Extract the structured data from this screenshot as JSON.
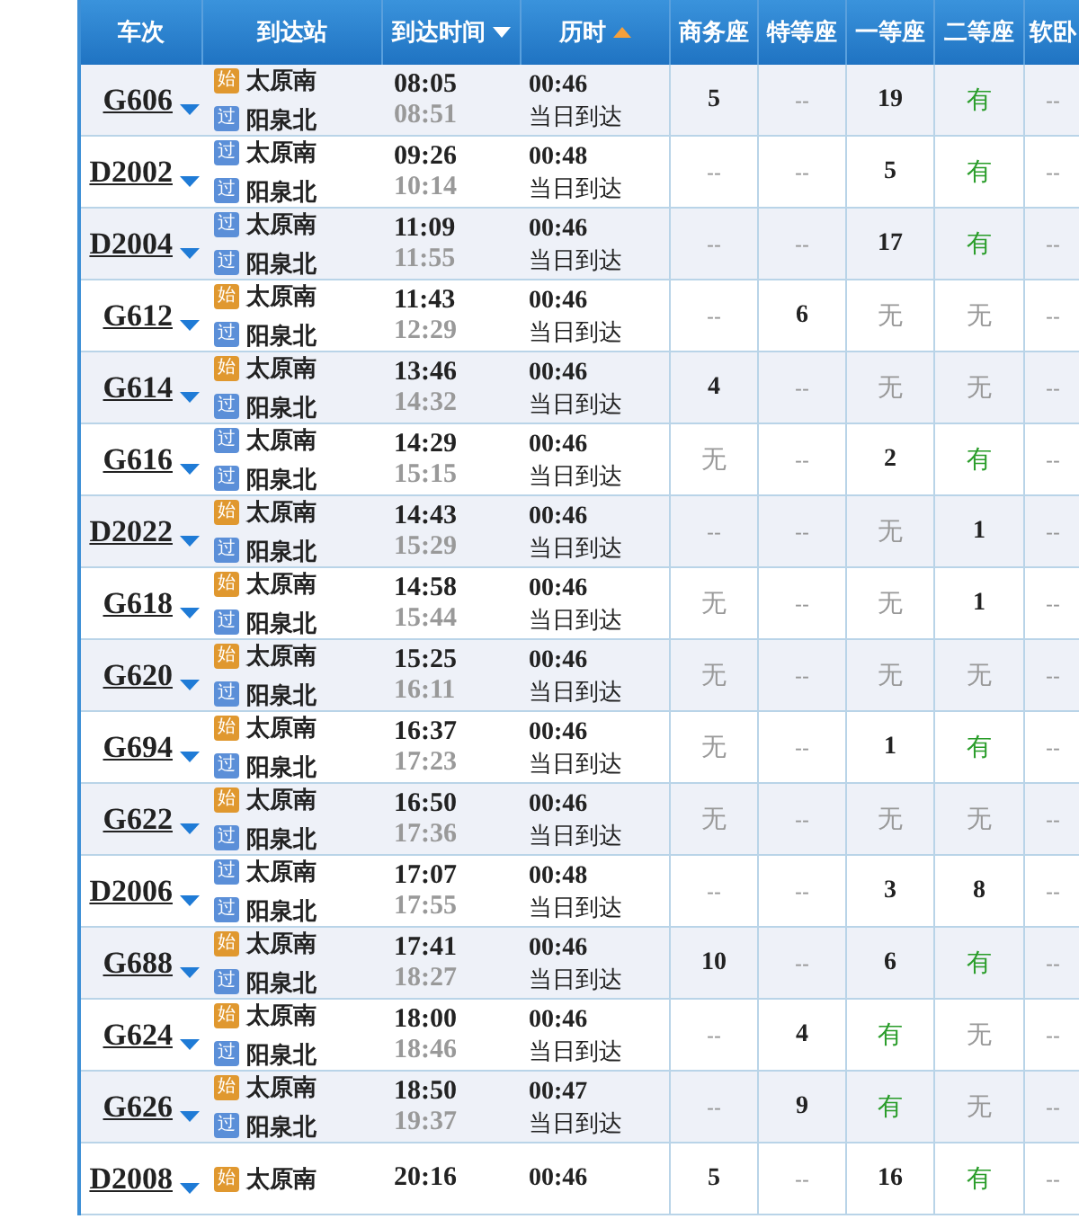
{
  "columns": [
    {
      "label": "车次"
    },
    {
      "label": "到达站"
    },
    {
      "label": "到达时间",
      "sorted": true,
      "descending": true
    },
    {
      "label": "历时",
      "sorted": true,
      "descending": false
    },
    {
      "label": "商务座"
    },
    {
      "label": "特等座"
    },
    {
      "label": "一等座"
    },
    {
      "label": "二等座"
    },
    {
      "label": "软卧"
    }
  ],
  "rows": [
    {
      "train": "G606",
      "from_badge": {
        "text": "始",
        "kind": "origin"
      },
      "from": "太原南",
      "to_badge": {
        "text": "过",
        "kind": "pass"
      },
      "to": "阳泉北",
      "depart": "08:05",
      "arrive": "08:51",
      "duration": "00:46",
      "arrival_day": "当日到达",
      "seats": [
        {
          "text": "5",
          "kind": "count"
        },
        {
          "text": "--",
          "kind": "na"
        },
        {
          "text": "19",
          "kind": "count"
        },
        {
          "text": "有",
          "kind": "available"
        },
        {
          "text": "--",
          "kind": "na"
        }
      ]
    },
    {
      "train": "D2002",
      "from_badge": {
        "text": "过",
        "kind": "pass"
      },
      "from": "太原南",
      "to_badge": {
        "text": "过",
        "kind": "pass"
      },
      "to": "阳泉北",
      "depart": "09:26",
      "arrive": "10:14",
      "duration": "00:48",
      "arrival_day": "当日到达",
      "seats": [
        {
          "text": "--",
          "kind": "na"
        },
        {
          "text": "--",
          "kind": "na"
        },
        {
          "text": "5",
          "kind": "count"
        },
        {
          "text": "有",
          "kind": "available"
        },
        {
          "text": "--",
          "kind": "na"
        }
      ]
    },
    {
      "train": "D2004",
      "from_badge": {
        "text": "过",
        "kind": "pass"
      },
      "from": "太原南",
      "to_badge": {
        "text": "过",
        "kind": "pass"
      },
      "to": "阳泉北",
      "depart": "11:09",
      "arrive": "11:55",
      "duration": "00:46",
      "arrival_day": "当日到达",
      "seats": [
        {
          "text": "--",
          "kind": "na"
        },
        {
          "text": "--",
          "kind": "na"
        },
        {
          "text": "17",
          "kind": "count"
        },
        {
          "text": "有",
          "kind": "available"
        },
        {
          "text": "--",
          "kind": "na"
        }
      ]
    },
    {
      "train": "G612",
      "from_badge": {
        "text": "始",
        "kind": "origin"
      },
      "from": "太原南",
      "to_badge": {
        "text": "过",
        "kind": "pass"
      },
      "to": "阳泉北",
      "depart": "11:43",
      "arrive": "12:29",
      "duration": "00:46",
      "arrival_day": "当日到达",
      "seats": [
        {
          "text": "--",
          "kind": "na"
        },
        {
          "text": "6",
          "kind": "count"
        },
        {
          "text": "无",
          "kind": "none"
        },
        {
          "text": "无",
          "kind": "none"
        },
        {
          "text": "--",
          "kind": "na"
        }
      ]
    },
    {
      "train": "G614",
      "from_badge": {
        "text": "始",
        "kind": "origin"
      },
      "from": "太原南",
      "to_badge": {
        "text": "过",
        "kind": "pass"
      },
      "to": "阳泉北",
      "depart": "13:46",
      "arrive": "14:32",
      "duration": "00:46",
      "arrival_day": "当日到达",
      "seats": [
        {
          "text": "4",
          "kind": "count"
        },
        {
          "text": "--",
          "kind": "na"
        },
        {
          "text": "无",
          "kind": "none"
        },
        {
          "text": "无",
          "kind": "none"
        },
        {
          "text": "--",
          "kind": "na"
        }
      ]
    },
    {
      "train": "G616",
      "from_badge": {
        "text": "过",
        "kind": "pass"
      },
      "from": "太原南",
      "to_badge": {
        "text": "过",
        "kind": "pass"
      },
      "to": "阳泉北",
      "depart": "14:29",
      "arrive": "15:15",
      "duration": "00:46",
      "arrival_day": "当日到达",
      "seats": [
        {
          "text": "无",
          "kind": "none"
        },
        {
          "text": "--",
          "kind": "na"
        },
        {
          "text": "2",
          "kind": "count"
        },
        {
          "text": "有",
          "kind": "available"
        },
        {
          "text": "--",
          "kind": "na"
        }
      ]
    },
    {
      "train": "D2022",
      "from_badge": {
        "text": "始",
        "kind": "origin"
      },
      "from": "太原南",
      "to_badge": {
        "text": "过",
        "kind": "pass"
      },
      "to": "阳泉北",
      "depart": "14:43",
      "arrive": "15:29",
      "duration": "00:46",
      "arrival_day": "当日到达",
      "seats": [
        {
          "text": "--",
          "kind": "na"
        },
        {
          "text": "--",
          "kind": "na"
        },
        {
          "text": "无",
          "kind": "none"
        },
        {
          "text": "1",
          "kind": "count"
        },
        {
          "text": "--",
          "kind": "na"
        }
      ]
    },
    {
      "train": "G618",
      "from_badge": {
        "text": "始",
        "kind": "origin"
      },
      "from": "太原南",
      "to_badge": {
        "text": "过",
        "kind": "pass"
      },
      "to": "阳泉北",
      "depart": "14:58",
      "arrive": "15:44",
      "duration": "00:46",
      "arrival_day": "当日到达",
      "seats": [
        {
          "text": "无",
          "kind": "none"
        },
        {
          "text": "--",
          "kind": "na"
        },
        {
          "text": "无",
          "kind": "none"
        },
        {
          "text": "1",
          "kind": "count"
        },
        {
          "text": "--",
          "kind": "na"
        }
      ]
    },
    {
      "train": "G620",
      "from_badge": {
        "text": "始",
        "kind": "origin"
      },
      "from": "太原南",
      "to_badge": {
        "text": "过",
        "kind": "pass"
      },
      "to": "阳泉北",
      "depart": "15:25",
      "arrive": "16:11",
      "duration": "00:46",
      "arrival_day": "当日到达",
      "seats": [
        {
          "text": "无",
          "kind": "none"
        },
        {
          "text": "--",
          "kind": "na"
        },
        {
          "text": "无",
          "kind": "none"
        },
        {
          "text": "无",
          "kind": "none"
        },
        {
          "text": "--",
          "kind": "na"
        }
      ]
    },
    {
      "train": "G694",
      "from_badge": {
        "text": "始",
        "kind": "origin"
      },
      "from": "太原南",
      "to_badge": {
        "text": "过",
        "kind": "pass"
      },
      "to": "阳泉北",
      "depart": "16:37",
      "arrive": "17:23",
      "duration": "00:46",
      "arrival_day": "当日到达",
      "seats": [
        {
          "text": "无",
          "kind": "none"
        },
        {
          "text": "--",
          "kind": "na"
        },
        {
          "text": "1",
          "kind": "count"
        },
        {
          "text": "有",
          "kind": "available"
        },
        {
          "text": "--",
          "kind": "na"
        }
      ]
    },
    {
      "train": "G622",
      "from_badge": {
        "text": "始",
        "kind": "origin"
      },
      "from": "太原南",
      "to_badge": {
        "text": "过",
        "kind": "pass"
      },
      "to": "阳泉北",
      "depart": "16:50",
      "arrive": "17:36",
      "duration": "00:46",
      "arrival_day": "当日到达",
      "seats": [
        {
          "text": "无",
          "kind": "none"
        },
        {
          "text": "--",
          "kind": "na"
        },
        {
          "text": "无",
          "kind": "none"
        },
        {
          "text": "无",
          "kind": "none"
        },
        {
          "text": "--",
          "kind": "na"
        }
      ]
    },
    {
      "train": "D2006",
      "from_badge": {
        "text": "过",
        "kind": "pass"
      },
      "from": "太原南",
      "to_badge": {
        "text": "过",
        "kind": "pass"
      },
      "to": "阳泉北",
      "depart": "17:07",
      "arrive": "17:55",
      "duration": "00:48",
      "arrival_day": "当日到达",
      "seats": [
        {
          "text": "--",
          "kind": "na"
        },
        {
          "text": "--",
          "kind": "na"
        },
        {
          "text": "3",
          "kind": "count"
        },
        {
          "text": "8",
          "kind": "count"
        },
        {
          "text": "--",
          "kind": "na"
        }
      ]
    },
    {
      "train": "G688",
      "from_badge": {
        "text": "始",
        "kind": "origin"
      },
      "from": "太原南",
      "to_badge": {
        "text": "过",
        "kind": "pass"
      },
      "to": "阳泉北",
      "depart": "17:41",
      "arrive": "18:27",
      "duration": "00:46",
      "arrival_day": "当日到达",
      "seats": [
        {
          "text": "10",
          "kind": "count"
        },
        {
          "text": "--",
          "kind": "na"
        },
        {
          "text": "6",
          "kind": "count"
        },
        {
          "text": "有",
          "kind": "available"
        },
        {
          "text": "--",
          "kind": "na"
        }
      ]
    },
    {
      "train": "G624",
      "from_badge": {
        "text": "始",
        "kind": "origin"
      },
      "from": "太原南",
      "to_badge": {
        "text": "过",
        "kind": "pass"
      },
      "to": "阳泉北",
      "depart": "18:00",
      "arrive": "18:46",
      "duration": "00:46",
      "arrival_day": "当日到达",
      "seats": [
        {
          "text": "--",
          "kind": "na"
        },
        {
          "text": "4",
          "kind": "count"
        },
        {
          "text": "有",
          "kind": "available"
        },
        {
          "text": "无",
          "kind": "none"
        },
        {
          "text": "--",
          "kind": "na"
        }
      ]
    },
    {
      "train": "G626",
      "from_badge": {
        "text": "始",
        "kind": "origin"
      },
      "from": "太原南",
      "to_badge": {
        "text": "过",
        "kind": "pass"
      },
      "to": "阳泉北",
      "depart": "18:50",
      "arrive": "19:37",
      "duration": "00:47",
      "arrival_day": "当日到达",
      "seats": [
        {
          "text": "--",
          "kind": "na"
        },
        {
          "text": "9",
          "kind": "count"
        },
        {
          "text": "有",
          "kind": "available"
        },
        {
          "text": "无",
          "kind": "none"
        },
        {
          "text": "--",
          "kind": "na"
        }
      ]
    },
    {
      "train": "D2008",
      "from_badge": {
        "text": "始",
        "kind": "origin"
      },
      "from": "太原南",
      "depart": "20:16",
      "duration": "00:46",
      "seats": [
        {
          "text": "5",
          "kind": "count"
        },
        {
          "text": "--",
          "kind": "na"
        },
        {
          "text": "16",
          "kind": "count"
        },
        {
          "text": "有",
          "kind": "available"
        },
        {
          "text": "--",
          "kind": "na"
        }
      ]
    }
  ]
}
